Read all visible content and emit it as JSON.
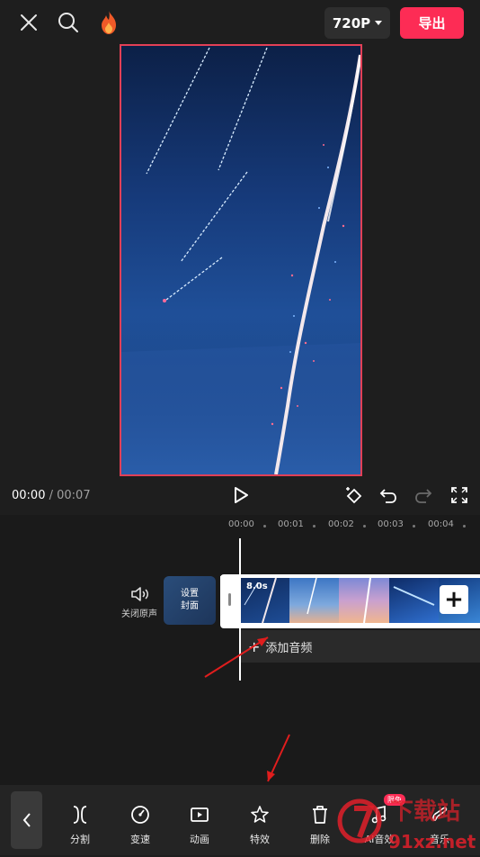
{
  "topbar": {
    "resolution_label": "720P",
    "export_label": "导出"
  },
  "playback": {
    "current_time": "00:00",
    "separator": " / ",
    "total_time": "00:07"
  },
  "ruler": {
    "ticks": [
      "00:00",
      "00:01",
      "00:02",
      "00:03",
      "00:04"
    ]
  },
  "track": {
    "mute_label": "关闭原声",
    "cover_label_line1": "设置",
    "cover_label_line2": "封面",
    "clip_duration": "8.0s",
    "add_audio_label": "添加音频"
  },
  "toolbar": {
    "items": [
      {
        "label": "分割",
        "icon": "split-icon"
      },
      {
        "label": "变速",
        "icon": "speed-icon"
      },
      {
        "label": "动画",
        "icon": "animation-icon"
      },
      {
        "label": "特效",
        "icon": "effects-icon"
      },
      {
        "label": "删除",
        "icon": "delete-icon"
      },
      {
        "label": "AI音效",
        "icon": "ai-sound-icon"
      },
      {
        "label": "音乐",
        "icon": "music-icon"
      }
    ],
    "badge_label": "限免"
  },
  "watermark": {
    "text": "91xz.net",
    "accent": "#e0202a"
  },
  "colors": {
    "accent": "#fd2c55",
    "preview_border": "#e24056",
    "annotation_arrow": "#e01d1d"
  }
}
